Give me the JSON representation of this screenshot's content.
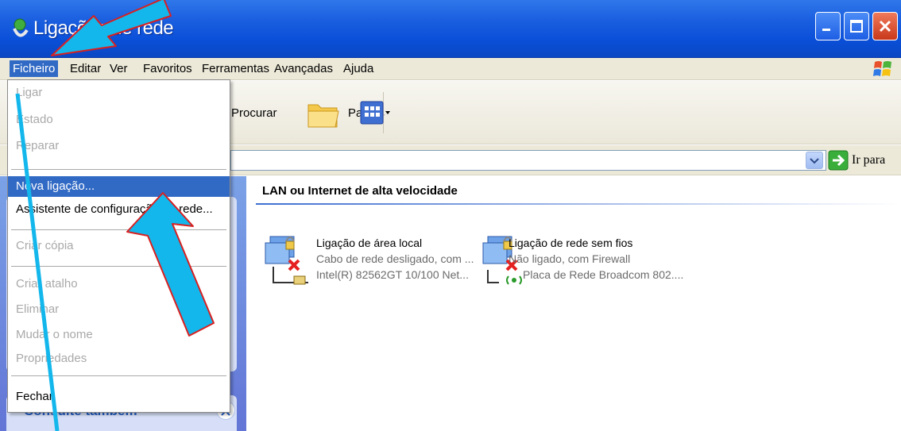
{
  "window": {
    "title": "Ligações de rede",
    "colors": {
      "titlebar": "#0a4fd8",
      "menu_highlight": "#316ac5",
      "arrow_fill": "#13b7ec",
      "arrow_outline": "#d82020"
    }
  },
  "menubar": {
    "items": [
      "Ficheiro",
      "Editar",
      "Ver",
      "Favoritos",
      "Ferramentas",
      "Avançadas",
      "Ajuda"
    ]
  },
  "toolbar": {
    "search_label": "Procurar",
    "folders_label": "Pastas",
    "views_icon": "views-icon"
  },
  "address": {
    "go_label": "Ir para"
  },
  "file_menu": {
    "items": [
      {
        "label": "Ligar",
        "enabled": false
      },
      {
        "label": "Estado",
        "enabled": false
      },
      {
        "label": "Reparar",
        "enabled": false
      },
      {
        "label": "Nova ligação...",
        "enabled": true,
        "highlighted": true
      },
      {
        "label": "Assistente de configuração de rede...",
        "enabled": true
      },
      {
        "label": "Criar cópia",
        "enabled": false
      },
      {
        "label": "Criar atalho",
        "enabled": false
      },
      {
        "label": "Eliminar",
        "enabled": false
      },
      {
        "label": "Mudar o nome",
        "enabled": false
      },
      {
        "label": "Propriedades",
        "enabled": false
      },
      {
        "label": "Fechar",
        "enabled": true
      }
    ]
  },
  "taskpane": {
    "see_also_header": "Consulte também"
  },
  "content": {
    "group_header": "LAN ou Internet de alta velocidade",
    "connections": [
      {
        "name": "Ligação de área local",
        "status": "Cabo de rede desligado, com ...",
        "device": "Intel(R) 82562GT 10/100 Net..."
      },
      {
        "name": "Ligação de rede sem fios",
        "status": "Não ligado, com Firewall",
        "device": "Placa de Rede Broadcom 802...."
      }
    ]
  }
}
